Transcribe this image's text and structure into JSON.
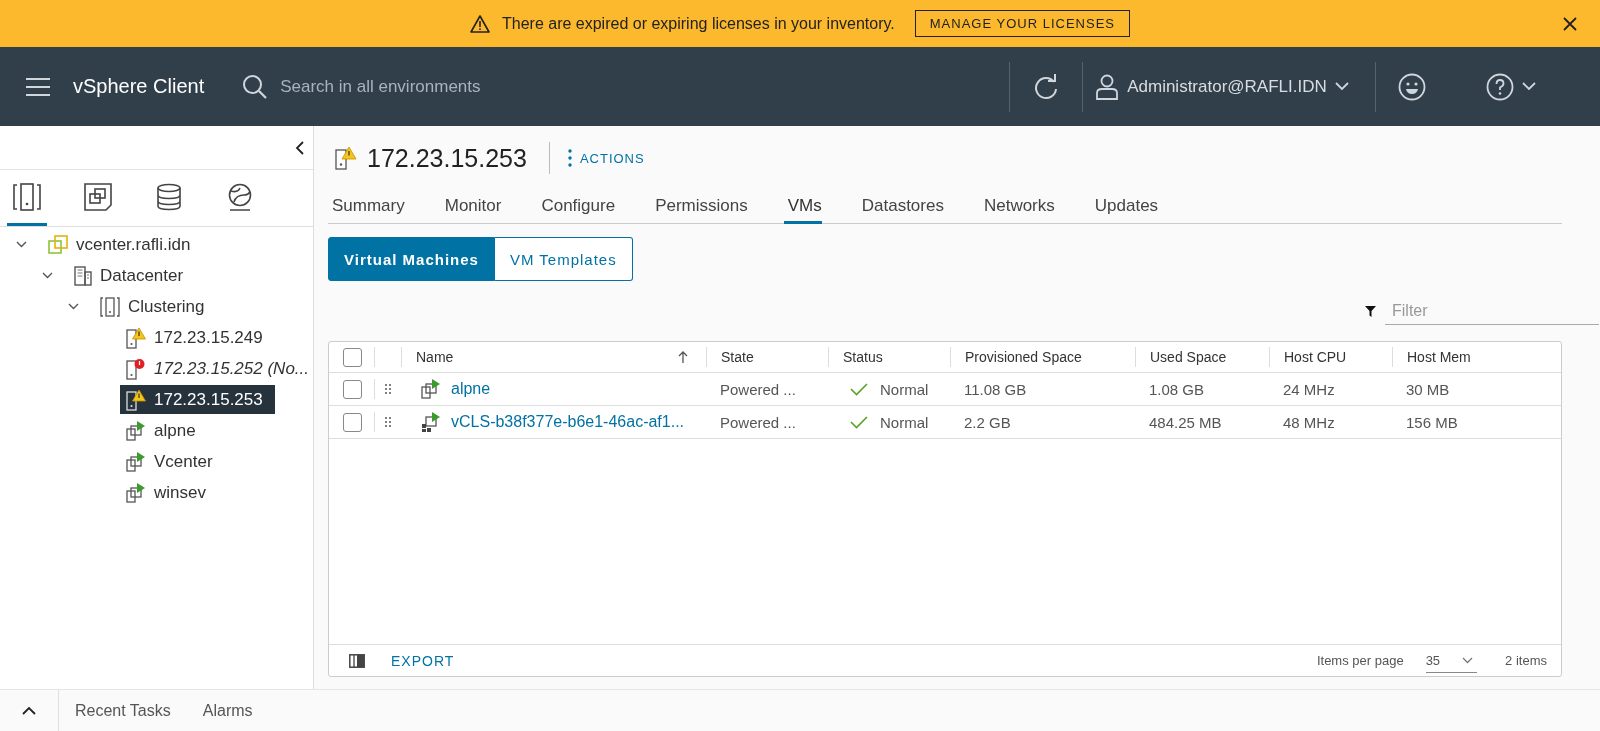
{
  "banner": {
    "message": "There are expired or expiring licenses in your inventory.",
    "button": "MANAGE YOUR LICENSES"
  },
  "header": {
    "app_title": "vSphere Client",
    "search": {
      "placeholder": "Search in all environments"
    },
    "user": "Administrator@RAFLI.IDN"
  },
  "sidebar": {
    "nav_icons": [
      {
        "kind": "hosts",
        "selected": true
      },
      {
        "kind": "vms",
        "selected": false
      },
      {
        "kind": "storage",
        "selected": false
      },
      {
        "kind": "network",
        "selected": false
      }
    ],
    "tree": [
      {
        "kind": "vcenter",
        "label": "vcenter.rafli.idn",
        "expanded": true,
        "selected": false,
        "children": [
          {
            "kind": "datacenter",
            "label": "Datacenter",
            "expanded": true,
            "selected": false,
            "children": [
              {
                "kind": "cluster",
                "label": "Clustering",
                "expanded": true,
                "selected": false,
                "children": [
                  {
                    "kind": "host",
                    "label": "172.23.15.249",
                    "warning": true,
                    "error": false,
                    "disconnected": false,
                    "selected": false
                  },
                  {
                    "kind": "host",
                    "label": "172.23.15.252 (No...",
                    "warning": false,
                    "error": true,
                    "disconnected": true,
                    "selected": false
                  },
                  {
                    "kind": "host",
                    "label": "172.23.15.253",
                    "warning": true,
                    "error": false,
                    "disconnected": false,
                    "selected": true
                  },
                  {
                    "kind": "vm",
                    "label": "alpne",
                    "selected": false
                  },
                  {
                    "kind": "vm",
                    "label": "Vcenter",
                    "selected": false
                  },
                  {
                    "kind": "vm",
                    "label": "winsev",
                    "selected": false
                  }
                ]
              }
            ]
          }
        ]
      }
    ]
  },
  "object": {
    "title": "172.23.15.253",
    "warning": true,
    "actions": "ACTIONS"
  },
  "tabs": [
    {
      "label": "Summary",
      "selected": false
    },
    {
      "label": "Monitor",
      "selected": false
    },
    {
      "label": "Configure",
      "selected": false
    },
    {
      "label": "Permissions",
      "selected": false
    },
    {
      "label": "VMs",
      "selected": true
    },
    {
      "label": "Datastores",
      "selected": false
    },
    {
      "label": "Networks",
      "selected": false
    },
    {
      "label": "Updates",
      "selected": false
    }
  ],
  "subtabs": [
    {
      "label": "Virtual Machines",
      "selected": true
    },
    {
      "label": "VM Templates",
      "selected": false
    }
  ],
  "filter": {
    "placeholder": "Filter"
  },
  "table": {
    "all_checked": false,
    "columns": [
      "Name",
      "State",
      "Status",
      "Provisioned Space",
      "Used Space",
      "Host CPU",
      "Host Mem"
    ],
    "rows": [
      {
        "checked": false,
        "kind": "vm",
        "name": "alpne",
        "state": "Powered ...",
        "status": "Normal",
        "provisioned": "11.08 GB",
        "used": "1.08 GB",
        "cpu": "24 MHz",
        "mem": "30 MB"
      },
      {
        "checked": false,
        "kind": "vcls",
        "name": "vCLS-b38f377e-b6e1-46ac-af1...",
        "state": "Powered ...",
        "status": "Normal",
        "provisioned": "2.2 GB",
        "used": "484.25 MB",
        "cpu": "48 MHz",
        "mem": "156 MB"
      }
    ],
    "footer": {
      "export": "EXPORT",
      "items_per_page_label": "Items per page",
      "items_per_page": "35",
      "count": "2 items"
    }
  },
  "bottom_bar": {
    "tabs": [
      "Recent Tasks",
      "Alarms"
    ]
  }
}
